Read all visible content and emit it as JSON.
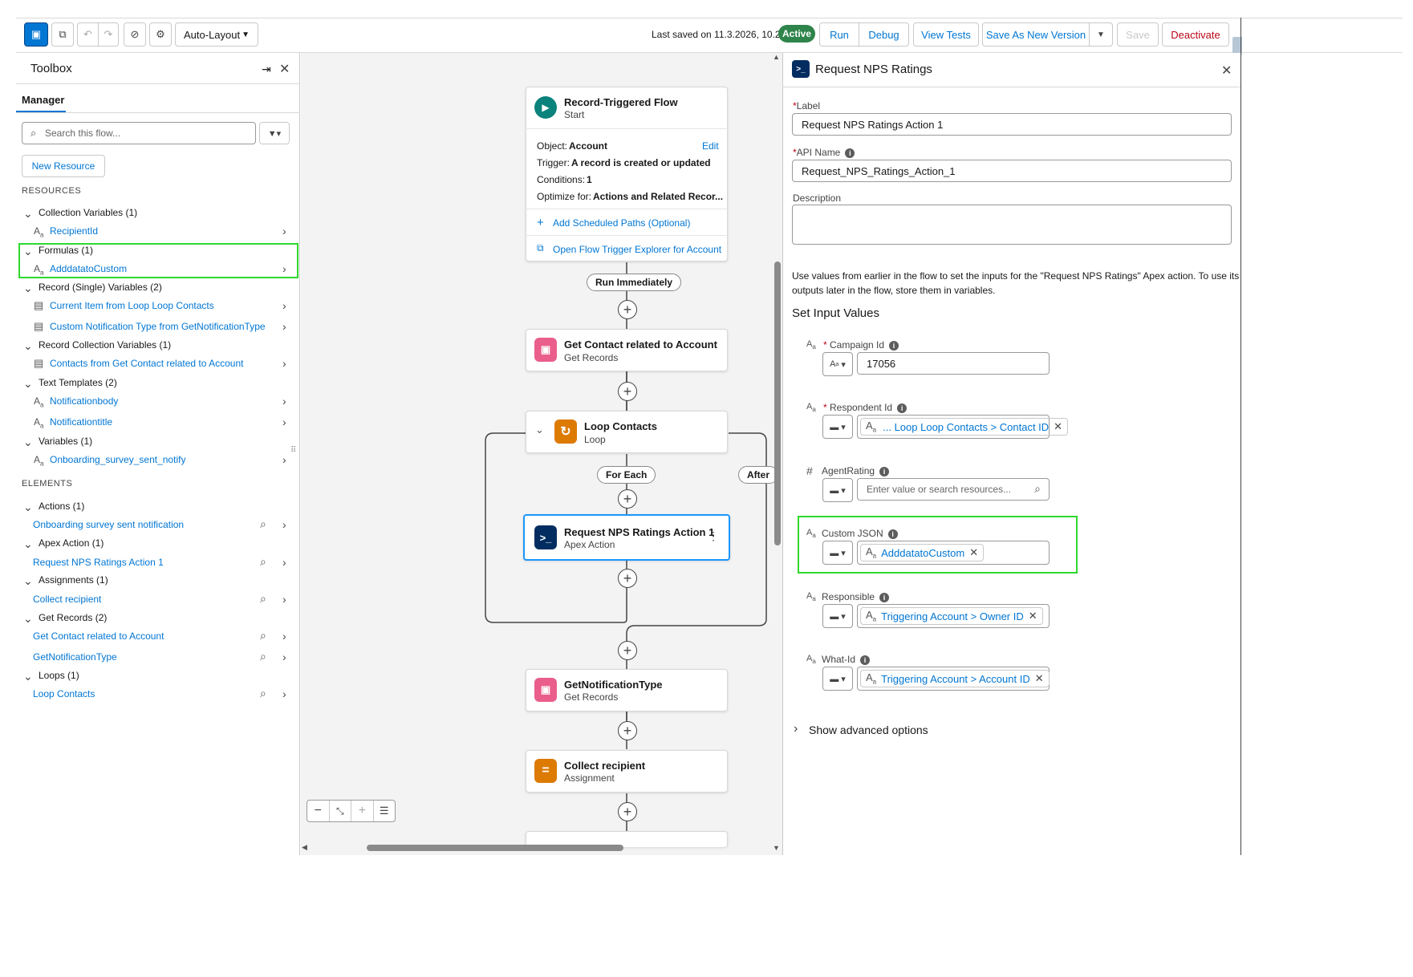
{
  "toolbar": {
    "layout_select": "Auto-Layout",
    "last_saved": "Last saved on 11.3.2026, 10.20",
    "status_badge": "Active",
    "run": "Run",
    "debug": "Debug",
    "view_tests": "View Tests",
    "save_as_new_version": "Save As New Version",
    "save": "Save",
    "deactivate": "Deactivate"
  },
  "toolbox": {
    "title": "Toolbox",
    "tab": "Manager",
    "search_placeholder": "Search this flow...",
    "new_resource": "New Resource",
    "resources_heading": "RESOURCES",
    "elements_heading": "ELEMENTS",
    "resources": [
      {
        "group": "Collection Variables (1)",
        "items": [
          "RecipientId"
        ]
      },
      {
        "group": "Formulas (1)",
        "items": [
          "AdddatatoCustom"
        ]
      },
      {
        "group": "Record (Single) Variables (2)",
        "items": [
          "Current Item from Loop Loop Contacts",
          "Custom Notification Type from GetNotificationType"
        ]
      },
      {
        "group": "Record Collection Variables (1)",
        "items": [
          "Contacts from Get Contact related to Account"
        ]
      },
      {
        "group": "Text Templates (2)",
        "items": [
          "Notificationbody",
          "Notificationtitle"
        ]
      },
      {
        "group": "Variables (1)",
        "items": [
          "Onboarding_survey_sent_notify"
        ]
      }
    ],
    "elements": [
      {
        "group": "Actions (1)",
        "items": [
          "Onboarding survey sent notification"
        ]
      },
      {
        "group": "Apex Action (1)",
        "items": [
          "Request NPS Ratings Action 1"
        ]
      },
      {
        "group": "Assignments (1)",
        "items": [
          "Collect recipient"
        ]
      },
      {
        "group": "Get Records (2)",
        "items": [
          "Get Contact related to Account",
          "GetNotificationType"
        ]
      },
      {
        "group": "Loops (1)",
        "items": [
          "Loop Contacts"
        ]
      }
    ]
  },
  "canvas": {
    "start": {
      "title": "Record-Triggered Flow",
      "subtitle": "Start",
      "object_label": "Object:",
      "object_value": "Account",
      "edit": "Edit",
      "trigger_label": "Trigger:",
      "trigger_value": "A record is created or updated",
      "conditions_label": "Conditions:",
      "conditions_value": "1",
      "optimize_label": "Optimize for:",
      "optimize_value": "Actions and Related Recor...",
      "add_scheduled": "Add Scheduled Paths (Optional)",
      "open_explorer": "Open Flow Trigger Explorer for Account"
    },
    "run_immediately": "Run Immediately",
    "get_contact": {
      "title": "Get Contact related to Account",
      "subtitle": "Get Records"
    },
    "loop": {
      "title": "Loop Contacts",
      "subtitle": "Loop"
    },
    "for_each": "For Each",
    "after_last": "After",
    "apex": {
      "title": "Request NPS Ratings Action 1",
      "subtitle": "Apex Action"
    },
    "get_notification": {
      "title": "GetNotificationType",
      "subtitle": "Get Records"
    },
    "collect": {
      "title": "Collect recipient",
      "subtitle": "Assignment"
    }
  },
  "panel": {
    "title": "Request NPS Ratings",
    "label_label": "Label",
    "label_value": "Request NPS Ratings Action 1",
    "api_label": "API Name",
    "api_value": "Request_NPS_Ratings_Action_1",
    "description_label": "Description",
    "help_text": "Use values from earlier in the flow to set the inputs for the \"Request NPS Ratings\" Apex action. To use its",
    "help_text_2": "outputs later in the flow, store them in variables.",
    "set_input_values": "Set Input Values",
    "inputs": {
      "campaign": {
        "label": "Campaign Id",
        "value": "17056"
      },
      "respondent": {
        "label": "Respondent Id",
        "chip": "... Loop Loop Contacts > Contact ID"
      },
      "agent": {
        "label": "AgentRating",
        "placeholder": "Enter value or search resources..."
      },
      "custom": {
        "label": "Custom JSON",
        "chip": "AdddatatoCustom"
      },
      "responsible": {
        "label": "Responsible",
        "chip": "Triggering Account > Owner ID"
      },
      "what": {
        "label": "What-Id",
        "chip": "Triggering Account > Account ID"
      }
    },
    "show_advanced": "Show advanced options"
  }
}
